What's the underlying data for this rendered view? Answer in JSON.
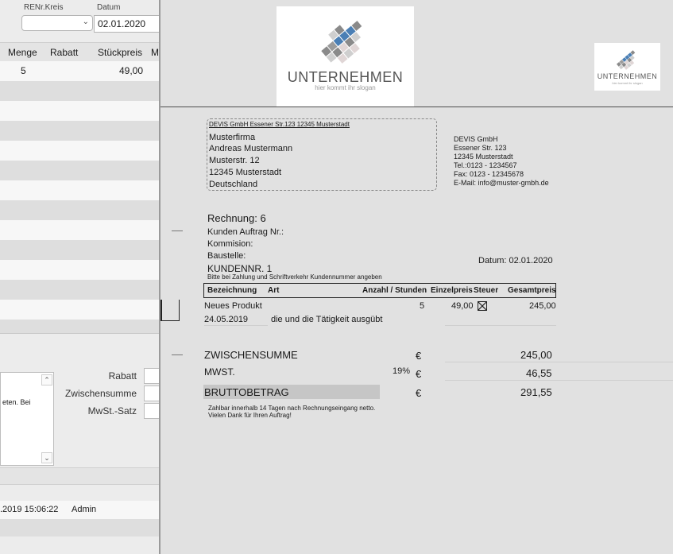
{
  "left_window": {
    "renr_kreis_label": "RENr.Kreis",
    "datum_label": "Datum",
    "datum_value": "02.01.2020",
    "columns": [
      "Menge",
      "Rabatt",
      "Stückpreis",
      "M"
    ],
    "first_row": {
      "menge": "5",
      "stueckpreis": "49,00"
    },
    "textarea_text": "eten. Bei",
    "rabatt_label": "Rabatt",
    "zwischensumme_label": "Zwischensumme",
    "mwst_satz_label": "MwSt.-Satz",
    "log_timestamp": ".2019 15:06:22",
    "log_user": "Admin"
  },
  "document": {
    "logo_large": {
      "name": "UNTERNEHMEN",
      "slogan": "hier kommt ihr slogan"
    },
    "logo_small": {
      "name": "UNTERNEHMEN",
      "slogan": "hier kommt ihr slogan"
    },
    "sender_line": "DEVIS GmbH Essener Str.123 12345 Musterstadt",
    "recipient": [
      "Musterfirma",
      "Andreas Mustermann",
      "Musterstr. 12",
      "12345 Musterstadt",
      "Deutschland"
    ],
    "company": [
      "DEVIS GmbH",
      "Essener Str. 123",
      "12345 Musterstadt",
      "Tel.:0123 - 1234567",
      "Fax: 0123 - 12345678",
      "E-Mail: info@muster-gmbh.de"
    ],
    "invoice_title": "Rechnung: 6",
    "kunden_auftrag": "Kunden Auftrag Nr.:",
    "kommision": "Kommision:",
    "baustelle": "Baustelle:",
    "kundennr": "KUNDENNR.  1",
    "hint": "Bitte bei Zahlung und Schriftverkehr Kundennummer angeben",
    "datum": "Datum: 02.01.2020",
    "table_headers": [
      "Bezeichnung",
      "Art",
      "Anzahl / Stunden",
      "Einzelpreis",
      "Steuer",
      "Gesamtpreis"
    ],
    "item": {
      "name": "Neues Produkt",
      "anzahl": "5",
      "einzelpreis": "49,00",
      "gesamtpreis": "245,00",
      "date": "24.05.2019",
      "description": "die und die Tätigkeit ausgübt"
    },
    "totals": {
      "zwischensumme_label": "ZWISCHENSUMME",
      "mwst_label": "MWST.",
      "mwst_rate": "19%",
      "brutto_label": "BRUTTOBETRAG",
      "currency": "€",
      "zwischensumme": "245,00",
      "mwst": "46,55",
      "brutto": "291,55"
    },
    "footer": [
      "Zahlbar innerhalb 14 Tagen nach Rechnungseingang netto.",
      "Vielen Dank für Ihren Auftrag!"
    ]
  },
  "colors": {
    "logo_blue": "#4a7fb5",
    "logo_grey": "#7f7f7f"
  }
}
